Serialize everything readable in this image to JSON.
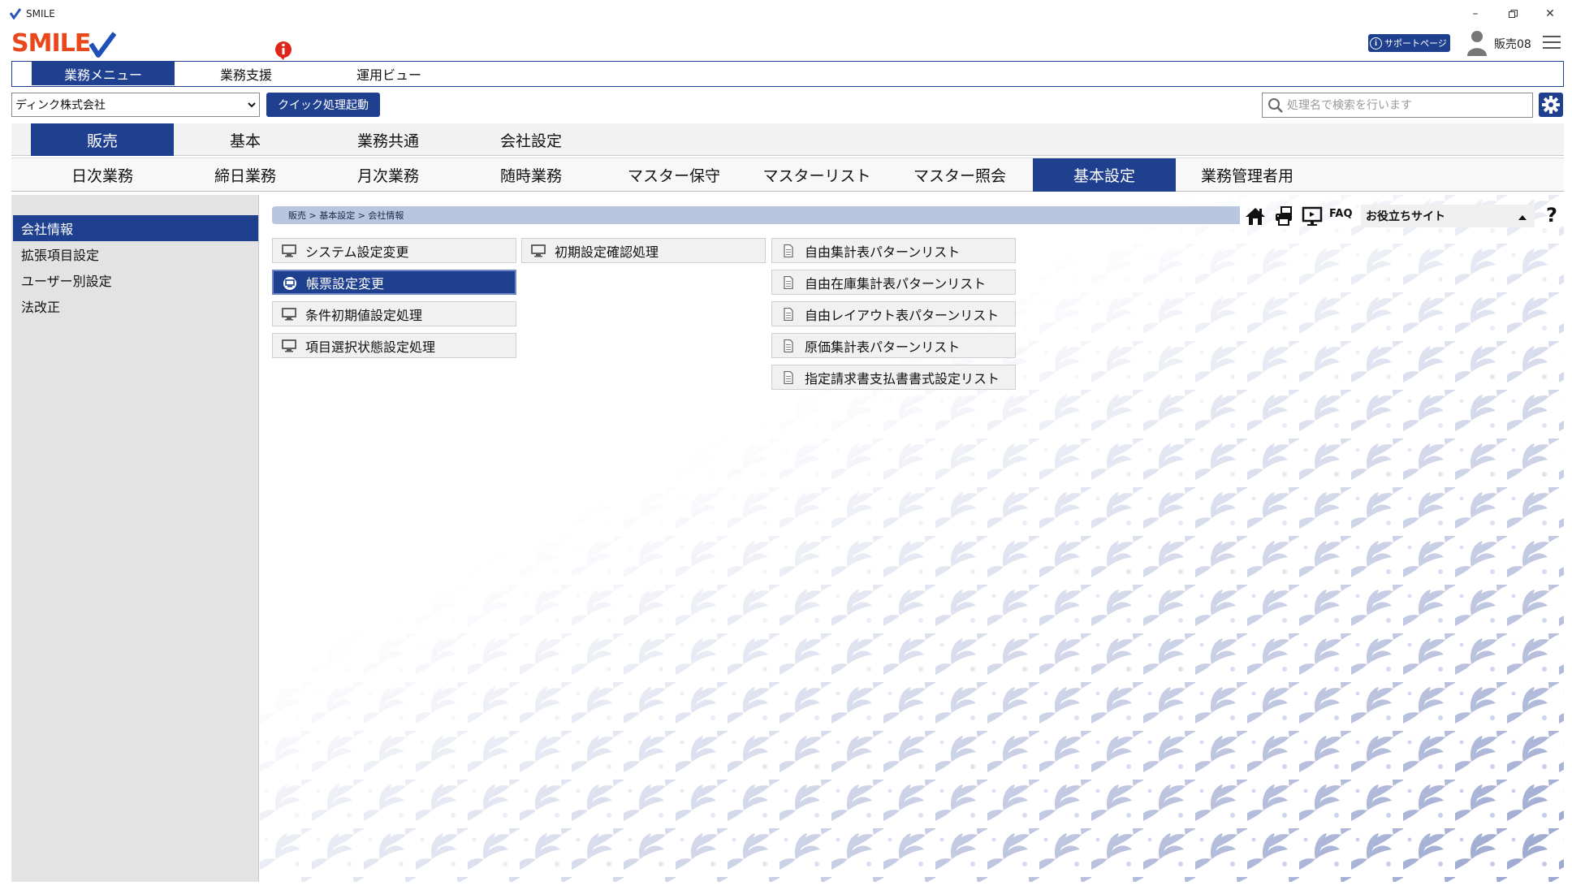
{
  "window": {
    "title": "SMILE",
    "brand": "SMILE"
  },
  "header": {
    "support_label": "サポートページ",
    "user_name": "販売08"
  },
  "topmenu": {
    "tabs": [
      {
        "label": "業務メニュー"
      },
      {
        "label": "業務支援"
      },
      {
        "label": "運用ビュー"
      }
    ],
    "active": 0
  },
  "toolbar": {
    "company": "ディンク株式会社",
    "quick_label": "クイック処理起動",
    "search_placeholder": "処理名で検索を行います"
  },
  "category_tabs": [
    {
      "label": "販売"
    },
    {
      "label": "基本"
    },
    {
      "label": "業務共通"
    },
    {
      "label": "会社設定"
    }
  ],
  "sub_tabs": [
    {
      "label": "日次業務"
    },
    {
      "label": "締日業務"
    },
    {
      "label": "月次業務"
    },
    {
      "label": "随時業務"
    },
    {
      "label": "マスター保守"
    },
    {
      "label": "マスターリスト"
    },
    {
      "label": "マスター照会"
    },
    {
      "label": "基本設定"
    },
    {
      "label": "業務管理者用"
    }
  ],
  "sidebar": {
    "items": [
      {
        "label": "会社情報"
      },
      {
        "label": "拡張項目設定"
      },
      {
        "label": "ユーザー別設定"
      },
      {
        "label": "法改正"
      }
    ]
  },
  "breadcrumb": "販売 > 基本設定 > 会社情報",
  "tools": {
    "faq": "FAQ",
    "useful_sites": "お役立ちサイト",
    "help": "?"
  },
  "functions": {
    "col1": [
      {
        "label": "システム設定変更"
      },
      {
        "label": "帳票設定変更"
      },
      {
        "label": "条件初期値設定処理"
      },
      {
        "label": "項目選択状態設定処理"
      }
    ],
    "col2": [
      {
        "label": "初期設定確認処理"
      }
    ],
    "col3": [
      {
        "label": "自由集計表パターンリスト"
      },
      {
        "label": "自由在庫集計表パターンリスト"
      },
      {
        "label": "自由レイアウト表パターンリスト"
      },
      {
        "label": "原価集計表パターンリスト"
      },
      {
        "label": "指定請求書支払書書式設定リスト"
      }
    ]
  },
  "colors": {
    "accent": "#1f3f8f",
    "brand": "#e8481c",
    "breadcrumb": "#b8c7df"
  }
}
